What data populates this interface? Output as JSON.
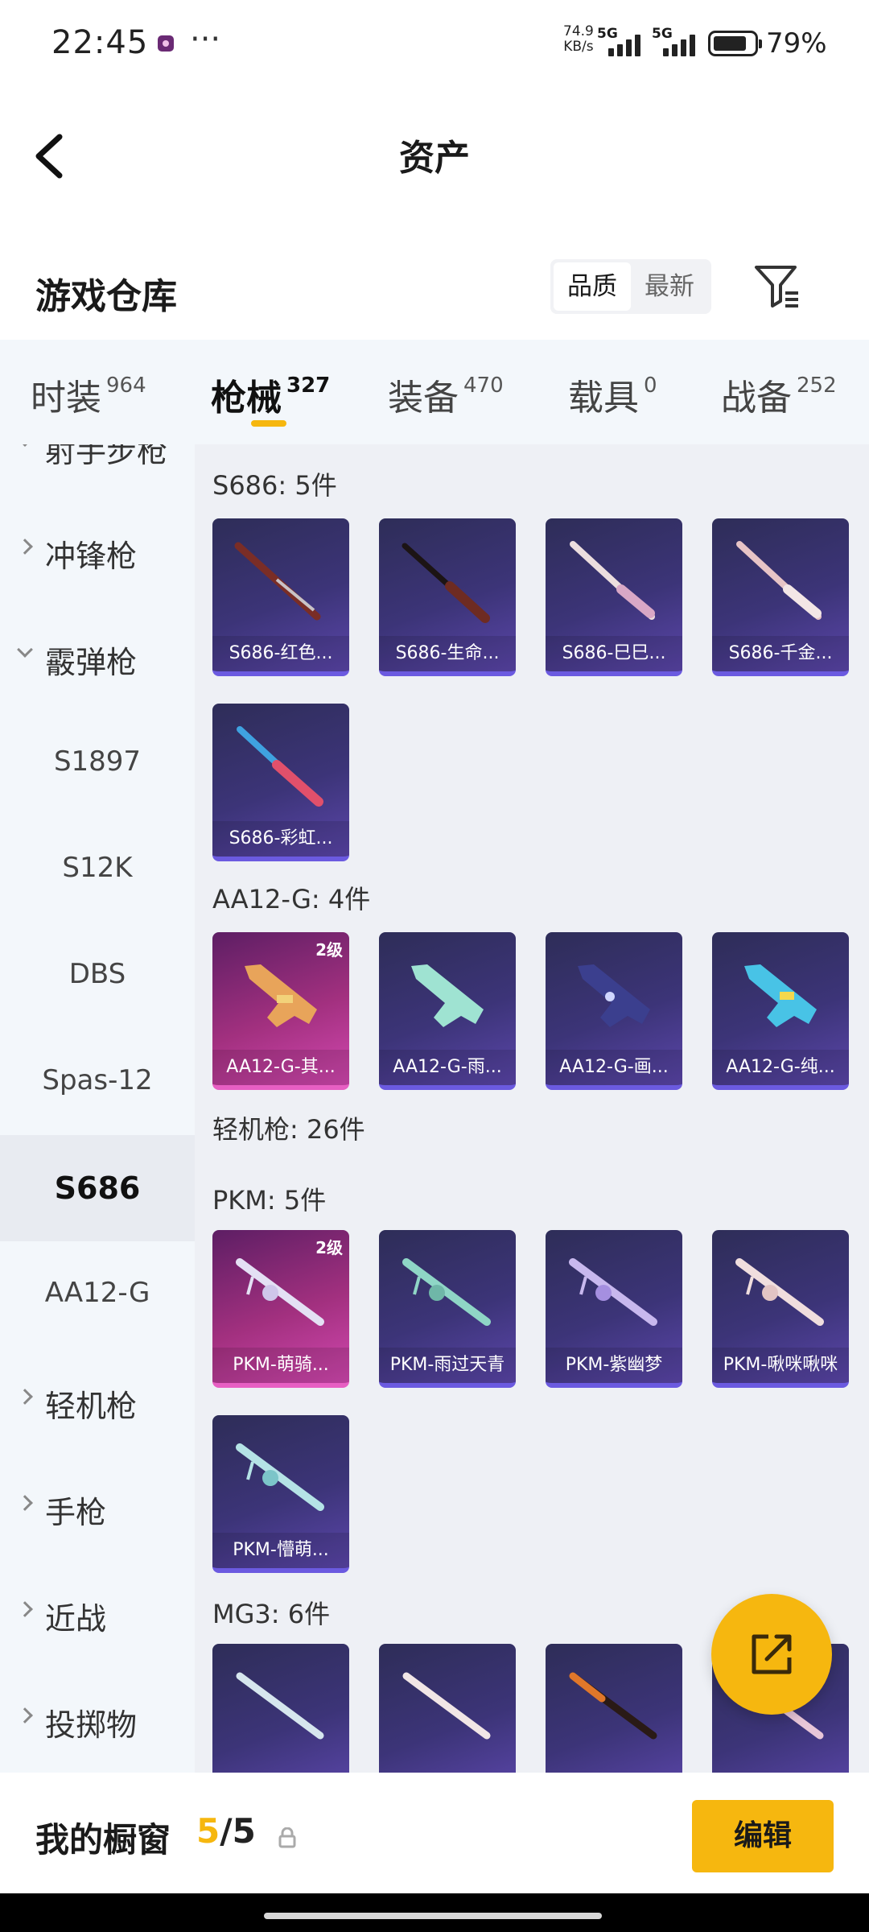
{
  "status_bar": {
    "time": "22:45",
    "dots": "···",
    "speed_value": "74.9",
    "speed_unit": "KB/s",
    "signal1": "5G",
    "signal2": "5G",
    "battery": "79%"
  },
  "header": {
    "title": "资产"
  },
  "warehouse": {
    "title": "游戏仓库",
    "sort_quality": "品质",
    "sort_newest": "最新"
  },
  "tabs": [
    {
      "label": "时装",
      "count": "964"
    },
    {
      "label": "枪械",
      "count": "327"
    },
    {
      "label": "装备",
      "count": "470"
    },
    {
      "label": "载具",
      "count": "0"
    },
    {
      "label": "战备",
      "count": "252"
    }
  ],
  "sidebar": {
    "top_partial": "射手步枪",
    "smg": "冲锋枪",
    "shotgun": "霰弹枪",
    "s1897": "S1897",
    "s12k": "S12K",
    "dbs": "DBS",
    "spas12": "Spas-12",
    "s686": "S686",
    "aa12g": "AA12-G",
    "lmg": "轻机枪",
    "pistol": "手枪",
    "melee": "近战",
    "throwable": "投掷物"
  },
  "sections": {
    "s686_title": "S686: 5件",
    "s686": [
      "S686-红色...",
      "S686-生命...",
      "S686-巳巳...",
      "S686-千金...",
      "S686-彩虹..."
    ],
    "aa12_title": "AA12-G: 4件",
    "aa12": [
      "AA12-G-其...",
      "AA12-G-雨...",
      "AA12-G-画...",
      "AA12-G-纯..."
    ],
    "aa12_level": "2级",
    "lmg_title": "轻机枪: 26件",
    "pkm_title": "PKM: 5件",
    "pkm": [
      "PKM-萌骑...",
      "PKM-雨过天青",
      "PKM-紫幽梦",
      "PKM-啾咪啾咪",
      "PKM-懵萌..."
    ],
    "pkm_level": "2级",
    "mg3_title": "MG3: 6件"
  },
  "bottom": {
    "title": "我的橱窗",
    "current": "5",
    "sep": "/",
    "max": "5",
    "edit": "编辑"
  },
  "colors": {
    "accent": "#f6b70f",
    "card_normal": "#3c3478",
    "card_rare": "#a2307f"
  }
}
